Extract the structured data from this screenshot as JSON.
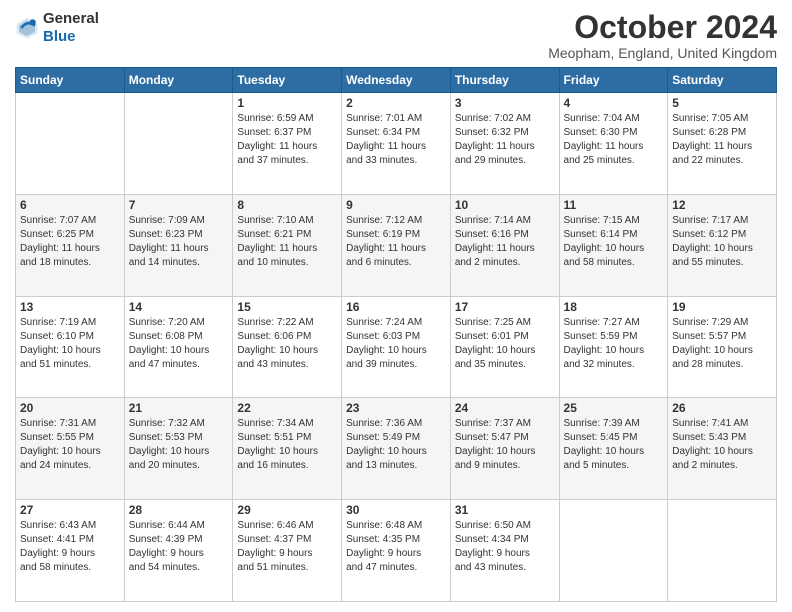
{
  "header": {
    "logo_general": "General",
    "logo_blue": "Blue",
    "month_title": "October 2024",
    "location": "Meopham, England, United Kingdom"
  },
  "weekdays": [
    "Sunday",
    "Monday",
    "Tuesday",
    "Wednesday",
    "Thursday",
    "Friday",
    "Saturday"
  ],
  "weeks": [
    [
      {
        "day": "",
        "info": ""
      },
      {
        "day": "",
        "info": ""
      },
      {
        "day": "1",
        "info": "Sunrise: 6:59 AM\nSunset: 6:37 PM\nDaylight: 11 hours\nand 37 minutes."
      },
      {
        "day": "2",
        "info": "Sunrise: 7:01 AM\nSunset: 6:34 PM\nDaylight: 11 hours\nand 33 minutes."
      },
      {
        "day": "3",
        "info": "Sunrise: 7:02 AM\nSunset: 6:32 PM\nDaylight: 11 hours\nand 29 minutes."
      },
      {
        "day": "4",
        "info": "Sunrise: 7:04 AM\nSunset: 6:30 PM\nDaylight: 11 hours\nand 25 minutes."
      },
      {
        "day": "5",
        "info": "Sunrise: 7:05 AM\nSunset: 6:28 PM\nDaylight: 11 hours\nand 22 minutes."
      }
    ],
    [
      {
        "day": "6",
        "info": "Sunrise: 7:07 AM\nSunset: 6:25 PM\nDaylight: 11 hours\nand 18 minutes."
      },
      {
        "day": "7",
        "info": "Sunrise: 7:09 AM\nSunset: 6:23 PM\nDaylight: 11 hours\nand 14 minutes."
      },
      {
        "day": "8",
        "info": "Sunrise: 7:10 AM\nSunset: 6:21 PM\nDaylight: 11 hours\nand 10 minutes."
      },
      {
        "day": "9",
        "info": "Sunrise: 7:12 AM\nSunset: 6:19 PM\nDaylight: 11 hours\nand 6 minutes."
      },
      {
        "day": "10",
        "info": "Sunrise: 7:14 AM\nSunset: 6:16 PM\nDaylight: 11 hours\nand 2 minutes."
      },
      {
        "day": "11",
        "info": "Sunrise: 7:15 AM\nSunset: 6:14 PM\nDaylight: 10 hours\nand 58 minutes."
      },
      {
        "day": "12",
        "info": "Sunrise: 7:17 AM\nSunset: 6:12 PM\nDaylight: 10 hours\nand 55 minutes."
      }
    ],
    [
      {
        "day": "13",
        "info": "Sunrise: 7:19 AM\nSunset: 6:10 PM\nDaylight: 10 hours\nand 51 minutes."
      },
      {
        "day": "14",
        "info": "Sunrise: 7:20 AM\nSunset: 6:08 PM\nDaylight: 10 hours\nand 47 minutes."
      },
      {
        "day": "15",
        "info": "Sunrise: 7:22 AM\nSunset: 6:06 PM\nDaylight: 10 hours\nand 43 minutes."
      },
      {
        "day": "16",
        "info": "Sunrise: 7:24 AM\nSunset: 6:03 PM\nDaylight: 10 hours\nand 39 minutes."
      },
      {
        "day": "17",
        "info": "Sunrise: 7:25 AM\nSunset: 6:01 PM\nDaylight: 10 hours\nand 35 minutes."
      },
      {
        "day": "18",
        "info": "Sunrise: 7:27 AM\nSunset: 5:59 PM\nDaylight: 10 hours\nand 32 minutes."
      },
      {
        "day": "19",
        "info": "Sunrise: 7:29 AM\nSunset: 5:57 PM\nDaylight: 10 hours\nand 28 minutes."
      }
    ],
    [
      {
        "day": "20",
        "info": "Sunrise: 7:31 AM\nSunset: 5:55 PM\nDaylight: 10 hours\nand 24 minutes."
      },
      {
        "day": "21",
        "info": "Sunrise: 7:32 AM\nSunset: 5:53 PM\nDaylight: 10 hours\nand 20 minutes."
      },
      {
        "day": "22",
        "info": "Sunrise: 7:34 AM\nSunset: 5:51 PM\nDaylight: 10 hours\nand 16 minutes."
      },
      {
        "day": "23",
        "info": "Sunrise: 7:36 AM\nSunset: 5:49 PM\nDaylight: 10 hours\nand 13 minutes."
      },
      {
        "day": "24",
        "info": "Sunrise: 7:37 AM\nSunset: 5:47 PM\nDaylight: 10 hours\nand 9 minutes."
      },
      {
        "day": "25",
        "info": "Sunrise: 7:39 AM\nSunset: 5:45 PM\nDaylight: 10 hours\nand 5 minutes."
      },
      {
        "day": "26",
        "info": "Sunrise: 7:41 AM\nSunset: 5:43 PM\nDaylight: 10 hours\nand 2 minutes."
      }
    ],
    [
      {
        "day": "27",
        "info": "Sunrise: 6:43 AM\nSunset: 4:41 PM\nDaylight: 9 hours\nand 58 minutes."
      },
      {
        "day": "28",
        "info": "Sunrise: 6:44 AM\nSunset: 4:39 PM\nDaylight: 9 hours\nand 54 minutes."
      },
      {
        "day": "29",
        "info": "Sunrise: 6:46 AM\nSunset: 4:37 PM\nDaylight: 9 hours\nand 51 minutes."
      },
      {
        "day": "30",
        "info": "Sunrise: 6:48 AM\nSunset: 4:35 PM\nDaylight: 9 hours\nand 47 minutes."
      },
      {
        "day": "31",
        "info": "Sunrise: 6:50 AM\nSunset: 4:34 PM\nDaylight: 9 hours\nand 43 minutes."
      },
      {
        "day": "",
        "info": ""
      },
      {
        "day": "",
        "info": ""
      }
    ]
  ]
}
